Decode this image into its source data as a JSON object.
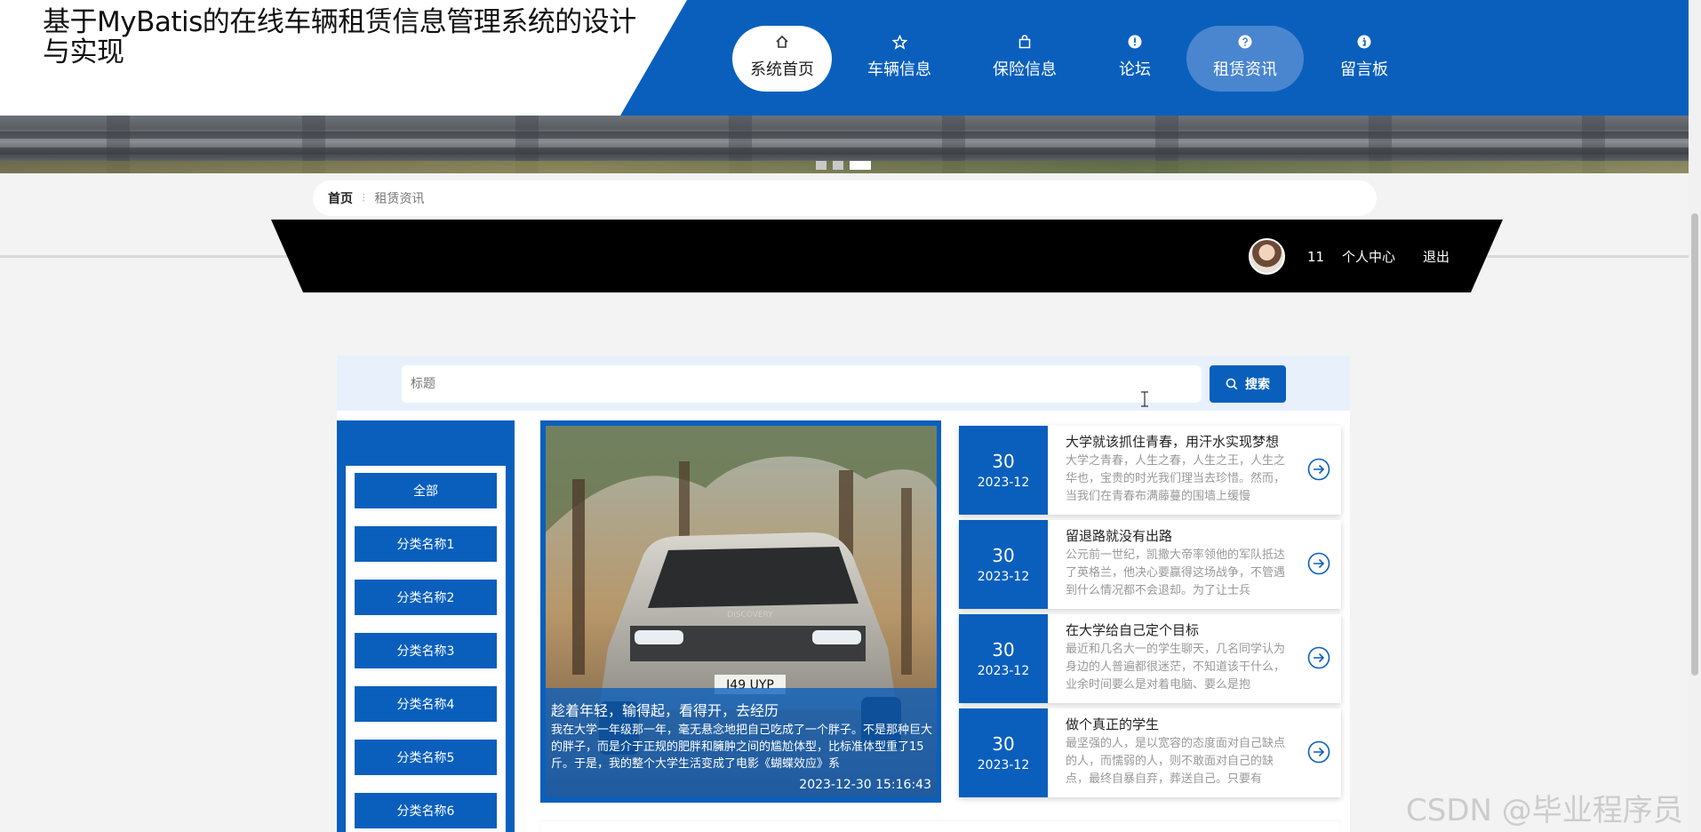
{
  "site": {
    "title": "基于MyBatis的在线车辆租赁信息管理系统的设计与实现"
  },
  "nav": [
    {
      "label": "系统首页",
      "icon": "home-icon",
      "state": "active"
    },
    {
      "label": "车辆信息",
      "icon": "star-icon",
      "state": "normal"
    },
    {
      "label": "保险信息",
      "icon": "bag-icon",
      "state": "normal"
    },
    {
      "label": "论坛",
      "icon": "info-circle-icon",
      "state": "normal"
    },
    {
      "label": "租赁资讯",
      "icon": "question-circle-icon",
      "state": "hover"
    },
    {
      "label": "留言板",
      "icon": "i-circle-icon",
      "state": "normal"
    }
  ],
  "breadcrumb": {
    "home": "首页",
    "current": "租赁资讯"
  },
  "user": {
    "name": "11",
    "center_link": "个人中心",
    "logout_link": "退出"
  },
  "search": {
    "placeholder": "标题",
    "button_label": "搜索"
  },
  "categories": [
    "全部",
    "分类名称1",
    "分类名称2",
    "分类名称3",
    "分类名称4",
    "分类名称5",
    "分类名称6"
  ],
  "featured": {
    "title": "趁着年轻，输得起，看得开，去经历",
    "summary": "我在大学一年级那一年，毫无悬念地把自己吃成了一个胖子。不是那种巨大的胖子，而是介于正规的肥胖和臃肿之间的尴尬体型，比标准体型重了15斤。于是，我的整个大学生活变成了电影《蝴蝶效应》系",
    "time": "2023-12-30 15:16:43",
    "plate": "I49 UYP",
    "brand_badge": "DISCOVERY"
  },
  "news": [
    {
      "day": "30",
      "ym": "2023-12",
      "title": "大学就该抓住青春，用汗水实现梦想",
      "summary": "大学之青春，人生之春，人生之王，人生之华也，宝贵的时光我们理当去珍惜。然而，当我们在青春布满藤蔓的围墙上缓慢"
    },
    {
      "day": "30",
      "ym": "2023-12",
      "title": "留退路就没有出路",
      "summary": "公元前一世纪，凯撒大帝率领他的军队抵达了英格兰，他决心要赢得这场战争，不管遇到什么情况都不会退却。为了让士兵"
    },
    {
      "day": "30",
      "ym": "2023-12",
      "title": "在大学给自己定个目标",
      "summary": "最近和几名大一的学生聊天，几名同学认为身边的人普遍都很迷茫，不知道该干什么，业余时间要么是对着电脑、要么是抱"
    },
    {
      "day": "30",
      "ym": "2023-12",
      "title": "做个真正的学生",
      "summary": "最坚强的人，是以宽容的态度面对自己缺点的人，而懦弱的人，则不敢面对自己的缺点，最终自暴自弃，葬送自己。只要有"
    }
  ],
  "watermark": "CSDN @毕业程序员",
  "colors": {
    "primary": "#0a5fbd",
    "nav_hover": "#4a86cf",
    "userbar": "#000000",
    "page_bg": "#f3f3f3"
  }
}
